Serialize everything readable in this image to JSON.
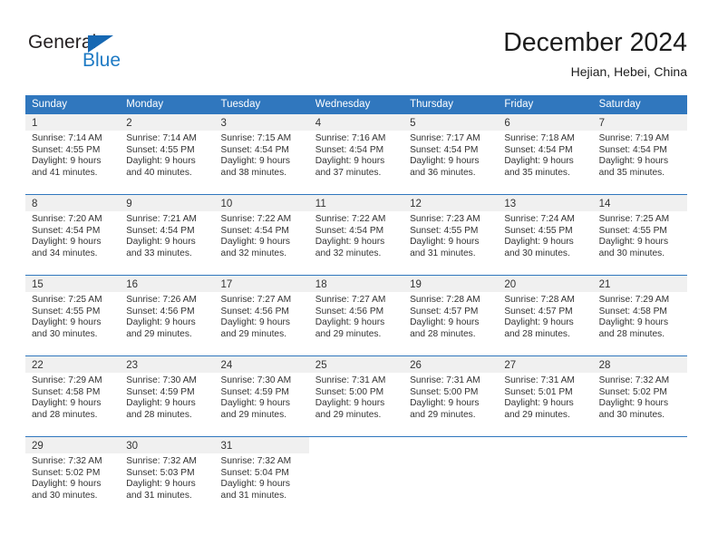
{
  "logo": {
    "word_one": "General",
    "word_two": "Blue",
    "triangle_color": "#1668b3",
    "blue_color": "#1e7ac4"
  },
  "header": {
    "title": "December 2024",
    "subtitle": "Hejian, Hebei, China"
  },
  "theme": {
    "header_blue": "#3077be",
    "number_band": "#f0f0f0",
    "text": "#333333"
  },
  "calendar": {
    "weekdays": [
      "Sunday",
      "Monday",
      "Tuesday",
      "Wednesday",
      "Thursday",
      "Friday",
      "Saturday"
    ],
    "weeks": [
      [
        {
          "day": "1",
          "sunrise": "Sunrise: 7:14 AM",
          "sunset": "Sunset: 4:55 PM",
          "daylight_1": "Daylight: 9 hours",
          "daylight_2": "and 41 minutes."
        },
        {
          "day": "2",
          "sunrise": "Sunrise: 7:14 AM",
          "sunset": "Sunset: 4:55 PM",
          "daylight_1": "Daylight: 9 hours",
          "daylight_2": "and 40 minutes."
        },
        {
          "day": "3",
          "sunrise": "Sunrise: 7:15 AM",
          "sunset": "Sunset: 4:54 PM",
          "daylight_1": "Daylight: 9 hours",
          "daylight_2": "and 38 minutes."
        },
        {
          "day": "4",
          "sunrise": "Sunrise: 7:16 AM",
          "sunset": "Sunset: 4:54 PM",
          "daylight_1": "Daylight: 9 hours",
          "daylight_2": "and 37 minutes."
        },
        {
          "day": "5",
          "sunrise": "Sunrise: 7:17 AM",
          "sunset": "Sunset: 4:54 PM",
          "daylight_1": "Daylight: 9 hours",
          "daylight_2": "and 36 minutes."
        },
        {
          "day": "6",
          "sunrise": "Sunrise: 7:18 AM",
          "sunset": "Sunset: 4:54 PM",
          "daylight_1": "Daylight: 9 hours",
          "daylight_2": "and 35 minutes."
        },
        {
          "day": "7",
          "sunrise": "Sunrise: 7:19 AM",
          "sunset": "Sunset: 4:54 PM",
          "daylight_1": "Daylight: 9 hours",
          "daylight_2": "and 35 minutes."
        }
      ],
      [
        {
          "day": "8",
          "sunrise": "Sunrise: 7:20 AM",
          "sunset": "Sunset: 4:54 PM",
          "daylight_1": "Daylight: 9 hours",
          "daylight_2": "and 34 minutes."
        },
        {
          "day": "9",
          "sunrise": "Sunrise: 7:21 AM",
          "sunset": "Sunset: 4:54 PM",
          "daylight_1": "Daylight: 9 hours",
          "daylight_2": "and 33 minutes."
        },
        {
          "day": "10",
          "sunrise": "Sunrise: 7:22 AM",
          "sunset": "Sunset: 4:54 PM",
          "daylight_1": "Daylight: 9 hours",
          "daylight_2": "and 32 minutes."
        },
        {
          "day": "11",
          "sunrise": "Sunrise: 7:22 AM",
          "sunset": "Sunset: 4:54 PM",
          "daylight_1": "Daylight: 9 hours",
          "daylight_2": "and 32 minutes."
        },
        {
          "day": "12",
          "sunrise": "Sunrise: 7:23 AM",
          "sunset": "Sunset: 4:55 PM",
          "daylight_1": "Daylight: 9 hours",
          "daylight_2": "and 31 minutes."
        },
        {
          "day": "13",
          "sunrise": "Sunrise: 7:24 AM",
          "sunset": "Sunset: 4:55 PM",
          "daylight_1": "Daylight: 9 hours",
          "daylight_2": "and 30 minutes."
        },
        {
          "day": "14",
          "sunrise": "Sunrise: 7:25 AM",
          "sunset": "Sunset: 4:55 PM",
          "daylight_1": "Daylight: 9 hours",
          "daylight_2": "and 30 minutes."
        }
      ],
      [
        {
          "day": "15",
          "sunrise": "Sunrise: 7:25 AM",
          "sunset": "Sunset: 4:55 PM",
          "daylight_1": "Daylight: 9 hours",
          "daylight_2": "and 30 minutes."
        },
        {
          "day": "16",
          "sunrise": "Sunrise: 7:26 AM",
          "sunset": "Sunset: 4:56 PM",
          "daylight_1": "Daylight: 9 hours",
          "daylight_2": "and 29 minutes."
        },
        {
          "day": "17",
          "sunrise": "Sunrise: 7:27 AM",
          "sunset": "Sunset: 4:56 PM",
          "daylight_1": "Daylight: 9 hours",
          "daylight_2": "and 29 minutes."
        },
        {
          "day": "18",
          "sunrise": "Sunrise: 7:27 AM",
          "sunset": "Sunset: 4:56 PM",
          "daylight_1": "Daylight: 9 hours",
          "daylight_2": "and 29 minutes."
        },
        {
          "day": "19",
          "sunrise": "Sunrise: 7:28 AM",
          "sunset": "Sunset: 4:57 PM",
          "daylight_1": "Daylight: 9 hours",
          "daylight_2": "and 28 minutes."
        },
        {
          "day": "20",
          "sunrise": "Sunrise: 7:28 AM",
          "sunset": "Sunset: 4:57 PM",
          "daylight_1": "Daylight: 9 hours",
          "daylight_2": "and 28 minutes."
        },
        {
          "day": "21",
          "sunrise": "Sunrise: 7:29 AM",
          "sunset": "Sunset: 4:58 PM",
          "daylight_1": "Daylight: 9 hours",
          "daylight_2": "and 28 minutes."
        }
      ],
      [
        {
          "day": "22",
          "sunrise": "Sunrise: 7:29 AM",
          "sunset": "Sunset: 4:58 PM",
          "daylight_1": "Daylight: 9 hours",
          "daylight_2": "and 28 minutes."
        },
        {
          "day": "23",
          "sunrise": "Sunrise: 7:30 AM",
          "sunset": "Sunset: 4:59 PM",
          "daylight_1": "Daylight: 9 hours",
          "daylight_2": "and 28 minutes."
        },
        {
          "day": "24",
          "sunrise": "Sunrise: 7:30 AM",
          "sunset": "Sunset: 4:59 PM",
          "daylight_1": "Daylight: 9 hours",
          "daylight_2": "and 29 minutes."
        },
        {
          "day": "25",
          "sunrise": "Sunrise: 7:31 AM",
          "sunset": "Sunset: 5:00 PM",
          "daylight_1": "Daylight: 9 hours",
          "daylight_2": "and 29 minutes."
        },
        {
          "day": "26",
          "sunrise": "Sunrise: 7:31 AM",
          "sunset": "Sunset: 5:00 PM",
          "daylight_1": "Daylight: 9 hours",
          "daylight_2": "and 29 minutes."
        },
        {
          "day": "27",
          "sunrise": "Sunrise: 7:31 AM",
          "sunset": "Sunset: 5:01 PM",
          "daylight_1": "Daylight: 9 hours",
          "daylight_2": "and 29 minutes."
        },
        {
          "day": "28",
          "sunrise": "Sunrise: 7:32 AM",
          "sunset": "Sunset: 5:02 PM",
          "daylight_1": "Daylight: 9 hours",
          "daylight_2": "and 30 minutes."
        }
      ],
      [
        {
          "day": "29",
          "sunrise": "Sunrise: 7:32 AM",
          "sunset": "Sunset: 5:02 PM",
          "daylight_1": "Daylight: 9 hours",
          "daylight_2": "and 30 minutes."
        },
        {
          "day": "30",
          "sunrise": "Sunrise: 7:32 AM",
          "sunset": "Sunset: 5:03 PM",
          "daylight_1": "Daylight: 9 hours",
          "daylight_2": "and 31 minutes."
        },
        {
          "day": "31",
          "sunrise": "Sunrise: 7:32 AM",
          "sunset": "Sunset: 5:04 PM",
          "daylight_1": "Daylight: 9 hours",
          "daylight_2": "and 31 minutes."
        },
        {
          "day": "",
          "sunrise": "",
          "sunset": "",
          "daylight_1": "",
          "daylight_2": ""
        },
        {
          "day": "",
          "sunrise": "",
          "sunset": "",
          "daylight_1": "",
          "daylight_2": ""
        },
        {
          "day": "",
          "sunrise": "",
          "sunset": "",
          "daylight_1": "",
          "daylight_2": ""
        },
        {
          "day": "",
          "sunrise": "",
          "sunset": "",
          "daylight_1": "",
          "daylight_2": ""
        }
      ]
    ]
  }
}
